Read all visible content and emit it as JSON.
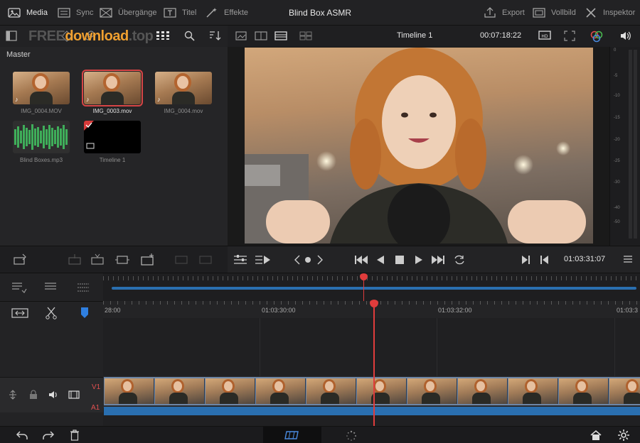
{
  "app_title": "Blind Box ASMR",
  "topbar": {
    "items": [
      {
        "label": "Media",
        "icon": "media-icon"
      },
      {
        "label": "Sync",
        "icon": "sync-icon"
      },
      {
        "label": "Übergänge",
        "icon": "transitions-icon"
      },
      {
        "label": "Titel",
        "icon": "titles-icon"
      },
      {
        "label": "Effekte",
        "icon": "effects-icon"
      }
    ],
    "right_items": [
      {
        "label": "Export",
        "icon": "export-icon"
      },
      {
        "label": "Vollbild",
        "icon": "fullscreen-icon"
      },
      {
        "label": "Inspektor",
        "icon": "inspector-icon"
      }
    ]
  },
  "watermark": {
    "free": "FREE",
    "download": "download",
    "top": ".top"
  },
  "media_pool": {
    "bin_label": "Master",
    "clips": [
      {
        "name": "IMG_0004.MOV",
        "kind": "video"
      },
      {
        "name": "IMG_0003.mov",
        "kind": "video",
        "selected": true
      },
      {
        "name": "IMG_0004.mov",
        "kind": "video"
      },
      {
        "name": "Blind Boxes.mp3",
        "kind": "audio"
      },
      {
        "name": "Timeline 1",
        "kind": "timeline"
      }
    ]
  },
  "viewer": {
    "timeline_name": "Timeline 1",
    "timecode": "00:07:18:22",
    "playhead_timecode": "01:03:31:07"
  },
  "meter": {
    "labels": [
      "0",
      "-5",
      "-10",
      "-15",
      "-20",
      "-25",
      "-30",
      "-40",
      "-50"
    ]
  },
  "timeline": {
    "ruler_labels": [
      "28:00",
      "01:03:30:00",
      "01:03:32:00",
      "01:03:3"
    ],
    "tracks": [
      {
        "label": "V1"
      },
      {
        "label": "A1"
      }
    ],
    "frame_count": 11
  },
  "colors": {
    "accent_red": "#e03c3c",
    "audio_blue": "#2a6fb0",
    "selection_red": "#d64545"
  }
}
